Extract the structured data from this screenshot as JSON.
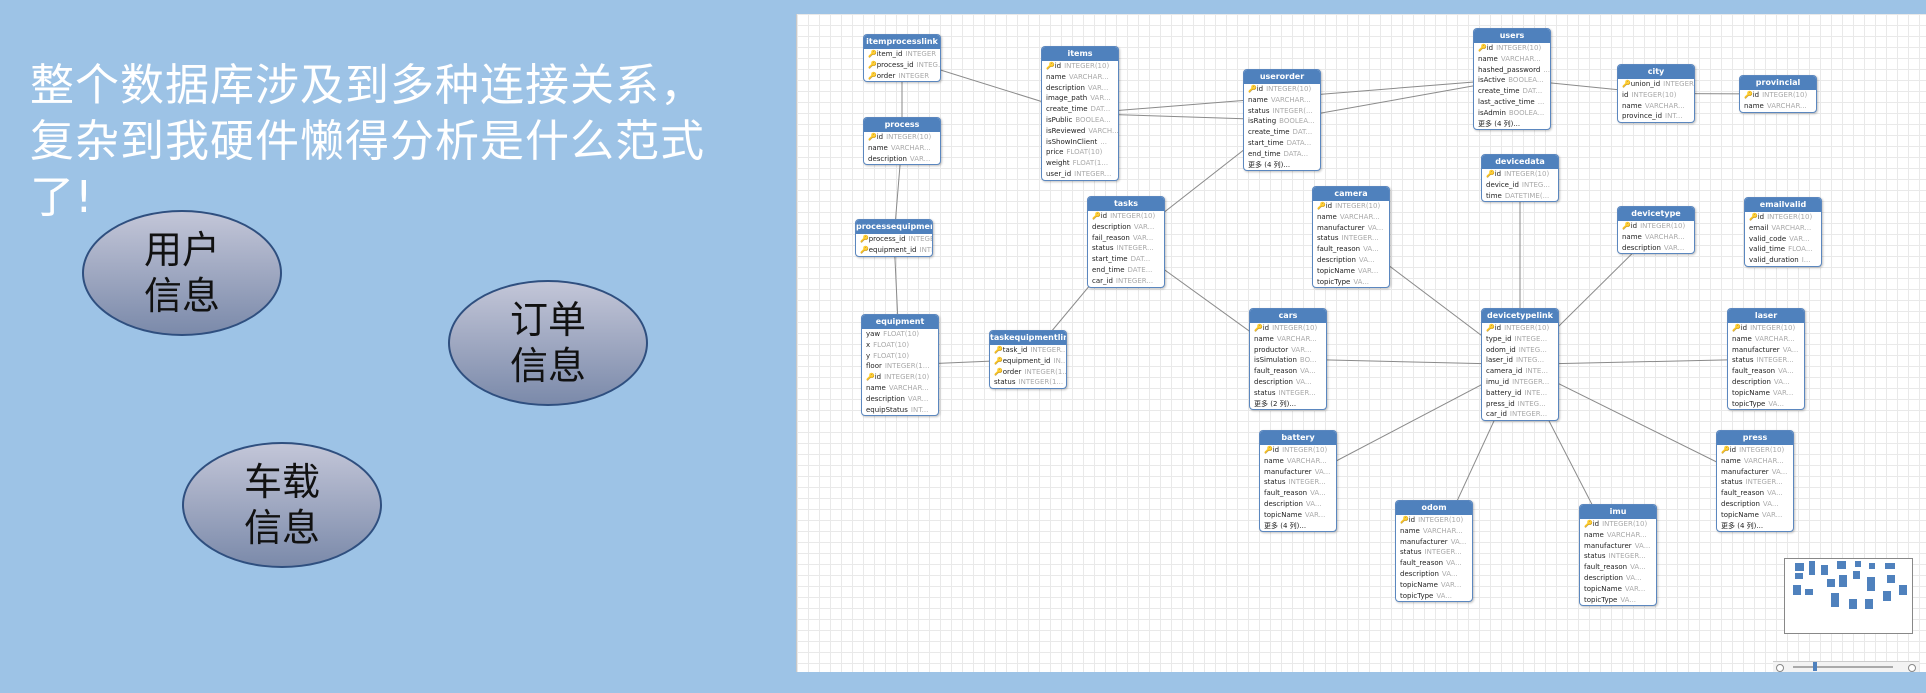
{
  "headline": "整个数据库涉及到多种连接关系，复杂到我硬件懒得分析是什么范式了!",
  "bubbles": {
    "user": "用户\n信息",
    "order": "订单\n信息",
    "vehicle": "车载\n信息"
  },
  "tables": {
    "itemprocesslink": {
      "title": "itemprocesslink",
      "fields": [
        {
          "name": "item_id",
          "type": "INTEGER",
          "key": true
        },
        {
          "name": "process_id",
          "type": "INTEG...",
          "key": true
        },
        {
          "name": "order",
          "type": "INTEGER",
          "key": true
        }
      ]
    },
    "process": {
      "title": "process",
      "fields": [
        {
          "name": "id",
          "type": "INTEGER(10)",
          "key": true
        },
        {
          "name": "name",
          "type": "VARCHAR...",
          "key": false
        },
        {
          "name": "description",
          "type": "VAR...",
          "key": false
        }
      ]
    },
    "processequipmentlink": {
      "title": "processequipmentlink",
      "fields": [
        {
          "name": "process_id",
          "type": "INTEGER...",
          "key": true
        },
        {
          "name": "equipment_id",
          "type": "INTEGER",
          "key": true
        }
      ]
    },
    "equipment": {
      "title": "equipment",
      "fields": [
        {
          "name": "yaw",
          "type": "FLOAT(10)",
          "key": false
        },
        {
          "name": "x",
          "type": "FLOAT(10)",
          "key": false
        },
        {
          "name": "y",
          "type": "FLOAT(10)",
          "key": false
        },
        {
          "name": "floor",
          "type": "INTEGER(1...",
          "key": false
        },
        {
          "name": "id",
          "type": "INTEGER(10)",
          "key": true
        },
        {
          "name": "name",
          "type": "VARCHAR...",
          "key": false
        },
        {
          "name": "description",
          "type": "VAR...",
          "key": false
        },
        {
          "name": "equipStatus",
          "type": "INT...",
          "key": false
        }
      ]
    },
    "items": {
      "title": "items",
      "fields": [
        {
          "name": "id",
          "type": "INTEGER(10)",
          "key": true
        },
        {
          "name": "name",
          "type": "VARCHAR...",
          "key": false
        },
        {
          "name": "description",
          "type": "VAR...",
          "key": false
        },
        {
          "name": "image_path",
          "type": "VAR...",
          "key": false
        },
        {
          "name": "create_time",
          "type": "DAT...",
          "key": false
        },
        {
          "name": "isPublic",
          "type": "BOOLEA...",
          "key": false
        },
        {
          "name": "isReviewed",
          "type": "VARCH...",
          "key": false
        },
        {
          "name": "isShowInClient",
          "type": "...",
          "key": false
        },
        {
          "name": "price",
          "type": "FLOAT(10)",
          "key": false
        },
        {
          "name": "weight",
          "type": "FLOAT(1...",
          "key": false
        },
        {
          "name": "user_id",
          "type": "INTEGER...",
          "key": false
        }
      ]
    },
    "tasks": {
      "title": "tasks",
      "fields": [
        {
          "name": "id",
          "type": "INTEGER(10)",
          "key": true
        },
        {
          "name": "description",
          "type": "VAR...",
          "key": false
        },
        {
          "name": "fail_reason",
          "type": "VAR...",
          "key": false
        },
        {
          "name": "status",
          "type": "INTEGER...",
          "key": false
        },
        {
          "name": "start_time",
          "type": "DAT...",
          "key": false
        },
        {
          "name": "end_time",
          "type": "DATE...",
          "key": false
        },
        {
          "name": "car_id",
          "type": "INTEGER...",
          "key": false
        }
      ]
    },
    "taskequipmentlink": {
      "title": "taskequipmentlink",
      "fields": [
        {
          "name": "task_id",
          "type": "INTEGER...",
          "key": true
        },
        {
          "name": "equipment_id",
          "type": "IN...",
          "key": true
        },
        {
          "name": "order",
          "type": "INTEGER(1...",
          "key": true
        },
        {
          "name": "status",
          "type": "INTEGER(1...",
          "key": false
        }
      ]
    },
    "userorder": {
      "title": "userorder",
      "fields": [
        {
          "name": "id",
          "type": "INTEGER(10)",
          "key": true
        },
        {
          "name": "name",
          "type": "VARCHAR...",
          "key": false
        },
        {
          "name": "status",
          "type": "INTEGER(...",
          "key": false
        },
        {
          "name": "isRating",
          "type": "BOOLEA...",
          "key": false
        },
        {
          "name": "create_time",
          "type": "DAT...",
          "key": false
        },
        {
          "name": "start_time",
          "type": "DATA...",
          "key": false
        },
        {
          "name": "end_time",
          "type": "DATA...",
          "key": false
        },
        {
          "name": "更多 (4 列)...",
          "type": "",
          "key": false
        }
      ]
    },
    "camera": {
      "title": "camera",
      "fields": [
        {
          "name": "id",
          "type": "INTEGER(10)",
          "key": true
        },
        {
          "name": "name",
          "type": "VARCHAR...",
          "key": false
        },
        {
          "name": "manufacturer",
          "type": "VA...",
          "key": false
        },
        {
          "name": "status",
          "type": "INTEGER...",
          "key": false
        },
        {
          "name": "fault_reason",
          "type": "VA...",
          "key": false
        },
        {
          "name": "description",
          "type": "VA...",
          "key": false
        },
        {
          "name": "topicName",
          "type": "VAR...",
          "key": false
        },
        {
          "name": "topicType",
          "type": "VA...",
          "key": false
        }
      ]
    },
    "cars": {
      "title": "cars",
      "fields": [
        {
          "name": "id",
          "type": "INTEGER(10)",
          "key": true
        },
        {
          "name": "name",
          "type": "VARCHAR...",
          "key": false
        },
        {
          "name": "productor",
          "type": "VAR...",
          "key": false
        },
        {
          "name": "isSimulation",
          "type": "BO...",
          "key": false
        },
        {
          "name": "fault_reason",
          "type": "VA...",
          "key": false
        },
        {
          "name": "description",
          "type": "VA...",
          "key": false
        },
        {
          "name": "status",
          "type": "INTEGER...",
          "key": false
        },
        {
          "name": "更多 (2 列)...",
          "type": "",
          "key": false
        }
      ]
    },
    "battery": {
      "title": "battery",
      "fields": [
        {
          "name": "id",
          "type": "INTEGER(10)",
          "key": true
        },
        {
          "name": "name",
          "type": "VARCHAR...",
          "key": false
        },
        {
          "name": "manufacturer",
          "type": "VA...",
          "key": false
        },
        {
          "name": "status",
          "type": "INTEGER...",
          "key": false
        },
        {
          "name": "fault_reason",
          "type": "VA...",
          "key": false
        },
        {
          "name": "description",
          "type": "VA...",
          "key": false
        },
        {
          "name": "topicName",
          "type": "VAR...",
          "key": false
        },
        {
          "name": "更多 (4 列)...",
          "type": "",
          "key": false
        }
      ]
    },
    "odom": {
      "title": "odom",
      "fields": [
        {
          "name": "id",
          "type": "INTEGER(10)",
          "key": true
        },
        {
          "name": "name",
          "type": "VARCHAR...",
          "key": false
        },
        {
          "name": "manufacturer",
          "type": "VA...",
          "key": false
        },
        {
          "name": "status",
          "type": "INTEGER...",
          "key": false
        },
        {
          "name": "fault_reason",
          "type": "VA...",
          "key": false
        },
        {
          "name": "description",
          "type": "VA...",
          "key": false
        },
        {
          "name": "topicName",
          "type": "VAR...",
          "key": false
        },
        {
          "name": "topicType",
          "type": "VA...",
          "key": false
        }
      ]
    },
    "users": {
      "title": "users",
      "fields": [
        {
          "name": "id",
          "type": "INTEGER(10)",
          "key": true
        },
        {
          "name": "name",
          "type": "VARCHAR...",
          "key": false
        },
        {
          "name": "hashed_password",
          "type": "...",
          "key": false
        },
        {
          "name": "isActive",
          "type": "BOOLEA...",
          "key": false
        },
        {
          "name": "create_time",
          "type": "DAT...",
          "key": false
        },
        {
          "name": "last_active_time",
          "type": "...",
          "key": false
        },
        {
          "name": "isAdmin",
          "type": "BOOLEA...",
          "key": false
        },
        {
          "name": "更多 (4 列)...",
          "type": "",
          "key": false
        }
      ]
    },
    "devicedata": {
      "title": "devicedata",
      "fields": [
        {
          "name": "id",
          "type": "INTEGER(10)",
          "key": true
        },
        {
          "name": "device_id",
          "type": "INTEG...",
          "key": false
        },
        {
          "name": "time",
          "type": "DATETIME(...",
          "key": false
        }
      ]
    },
    "devicetypelink": {
      "title": "devicetypelink",
      "fields": [
        {
          "name": "id",
          "type": "INTEGER(10)",
          "key": true
        },
        {
          "name": "type_id",
          "type": "INTEGE...",
          "key": false
        },
        {
          "name": "odom_id",
          "type": "INTEG...",
          "key": false
        },
        {
          "name": "laser_id",
          "type": "INTEG...",
          "key": false
        },
        {
          "name": "camera_id",
          "type": "INTE...",
          "key": false
        },
        {
          "name": "imu_id",
          "type": "INTEGER...",
          "key": false
        },
        {
          "name": "battery_id",
          "type": "INTE...",
          "key": false
        },
        {
          "name": "press_id",
          "type": "INTEG...",
          "key": false
        },
        {
          "name": "car_id",
          "type": "INTEGER...",
          "key": false
        }
      ]
    },
    "imu": {
      "title": "imu",
      "fields": [
        {
          "name": "id",
          "type": "INTEGER(10)",
          "key": true
        },
        {
          "name": "name",
          "type": "VARCHAR...",
          "key": false
        },
        {
          "name": "manufacturer",
          "type": "VA...",
          "key": false
        },
        {
          "name": "status",
          "type": "INTEGER...",
          "key": false
        },
        {
          "name": "fault_reason",
          "type": "VA...",
          "key": false
        },
        {
          "name": "description",
          "type": "VA...",
          "key": false
        },
        {
          "name": "topicName",
          "type": "VAR...",
          "key": false
        },
        {
          "name": "topicType",
          "type": "VA...",
          "key": false
        }
      ]
    },
    "city": {
      "title": "city",
      "fields": [
        {
          "name": "union_id",
          "type": "INTEGER...",
          "key": true
        },
        {
          "name": "id",
          "type": "INTEGER(10)",
          "key": false
        },
        {
          "name": "name",
          "type": "VARCHAR...",
          "key": false
        },
        {
          "name": "province_id",
          "type": "INT...",
          "key": false
        }
      ]
    },
    "provincial": {
      "title": "provincial",
      "fields": [
        {
          "name": "id",
          "type": "INTEGER(10)",
          "key": true
        },
        {
          "name": "name",
          "type": "VARCHAR...",
          "key": false
        }
      ]
    },
    "devicetype": {
      "title": "devicetype",
      "fields": [
        {
          "name": "id",
          "type": "INTEGER(10)",
          "key": true
        },
        {
          "name": "name",
          "type": "VARCHAR...",
          "key": false
        },
        {
          "name": "description",
          "type": "VAR...",
          "key": false
        }
      ]
    },
    "emailvalid": {
      "title": "emailvalid",
      "fields": [
        {
          "name": "id",
          "type": "INTEGER(10)",
          "key": true
        },
        {
          "name": "email",
          "type": "VARCHAR...",
          "key": false
        },
        {
          "name": "valid_code",
          "type": "VAR...",
          "key": false
        },
        {
          "name": "valid_time",
          "type": "FLOA...",
          "key": false
        },
        {
          "name": "valid_duration",
          "type": "I...",
          "key": false
        }
      ]
    },
    "laser": {
      "title": "laser",
      "fields": [
        {
          "name": "id",
          "type": "INTEGER(10)",
          "key": true
        },
        {
          "name": "name",
          "type": "VARCHAR...",
          "key": false
        },
        {
          "name": "manufacturer",
          "type": "VA...",
          "key": false
        },
        {
          "name": "status",
          "type": "INTEGER...",
          "key": false
        },
        {
          "name": "fault_reason",
          "type": "VA...",
          "key": false
        },
        {
          "name": "description",
          "type": "VA...",
          "key": false
        },
        {
          "name": "topicName",
          "type": "VAR...",
          "key": false
        },
        {
          "name": "topicType",
          "type": "VA...",
          "key": false
        }
      ]
    },
    "press": {
      "title": "press",
      "fields": [
        {
          "name": "id",
          "type": "INTEGER(10)",
          "key": true
        },
        {
          "name": "name",
          "type": "VARCHAR...",
          "key": false
        },
        {
          "name": "manufacturer",
          "type": "VA...",
          "key": false
        },
        {
          "name": "status",
          "type": "INTEGER...",
          "key": false
        },
        {
          "name": "fault_reason",
          "type": "VA...",
          "key": false
        },
        {
          "name": "description",
          "type": "VA...",
          "key": false
        },
        {
          "name": "topicName",
          "type": "VAR...",
          "key": false
        },
        {
          "name": "更多 (4 列)...",
          "type": "",
          "key": false
        }
      ]
    }
  },
  "links": [
    [
      "itemprocesslink",
      "items"
    ],
    [
      "itemprocesslink",
      "process"
    ],
    [
      "process",
      "processequipmentlink"
    ],
    [
      "processequipmentlink",
      "equipment"
    ],
    [
      "equipment",
      "taskequipmentlink"
    ],
    [
      "taskequipmentlink",
      "tasks"
    ],
    [
      "items",
      "userorder"
    ],
    [
      "items",
      "users"
    ],
    [
      "userorder",
      "users"
    ],
    [
      "userorder",
      "tasks"
    ],
    [
      "tasks",
      "cars"
    ],
    [
      "users",
      "city"
    ],
    [
      "city",
      "provincial"
    ],
    [
      "devicedata",
      "devicetypelink"
    ],
    [
      "camera",
      "devicetypelink"
    ],
    [
      "cars",
      "devicetypelink"
    ],
    [
      "battery",
      "devicetypelink"
    ],
    [
      "odom",
      "devicetypelink"
    ],
    [
      "imu",
      "devicetypelink"
    ],
    [
      "devicetype",
      "devicetypelink"
    ],
    [
      "laser",
      "devicetypelink"
    ],
    [
      "press",
      "devicetypelink"
    ]
  ]
}
